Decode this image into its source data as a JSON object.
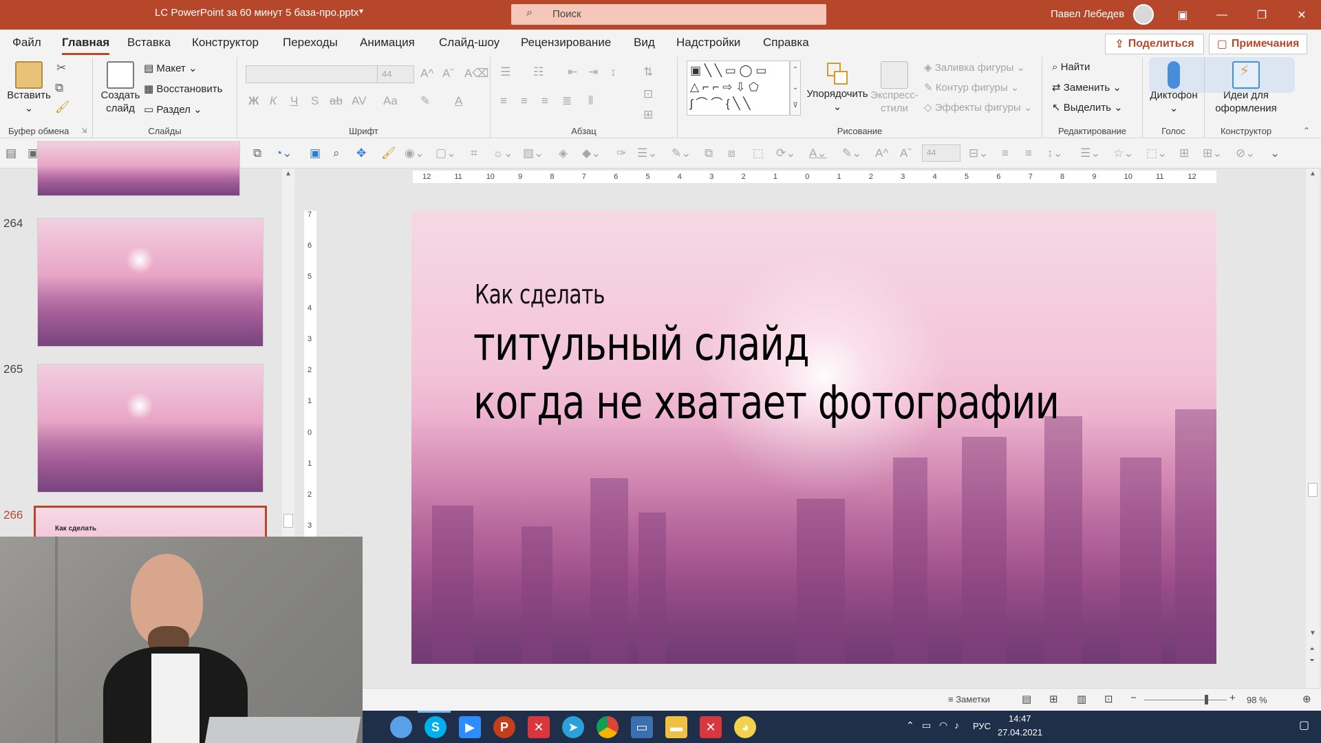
{
  "window": {
    "title": "LC PowerPoint за 60 минут 5 база-про.pptx",
    "search_placeholder": "Поиск",
    "user": "Павел Лебедев",
    "accent": "#b7472a"
  },
  "tabs": [
    "Файл",
    "Главная",
    "Вставка",
    "Конструктор",
    "Переходы",
    "Анимация",
    "Слайд-шоу",
    "Рецензирование",
    "Вид",
    "Надстройки",
    "Справка"
  ],
  "share_label": "Поделиться",
  "comments_label": "Примечания",
  "ribbon": {
    "clipboard": {
      "paste": "Вставить",
      "label": "Буфер обмена"
    },
    "slides": {
      "new_slide_line1": "Создать",
      "new_slide_line2": "слайд",
      "layout": "Макет",
      "reset": "Восстановить",
      "section": "Раздел",
      "label": "Слайды"
    },
    "font": {
      "size": "44",
      "label": "Шрифт",
      "bold": "Ж",
      "italic": "К",
      "underline": "Ч",
      "shadow": "S",
      "strike": "ab",
      "spacing": "AV",
      "case": "Aa"
    },
    "paragraph": {
      "label": "Абзац"
    },
    "drawing": {
      "arrange": "Упорядочить",
      "styles_line1": "Экспресс-",
      "styles_line2": "стили",
      "fill": "Заливка фигуры",
      "outline": "Контур фигуры",
      "effects": "Эффекты фигуры",
      "label": "Рисование"
    },
    "editing": {
      "find": "Найти",
      "replace": "Заменить",
      "select": "Выделить",
      "label": "Редактирование"
    },
    "voice": {
      "dictate": "Диктофон",
      "label": "Голос"
    },
    "designer": {
      "ideas_line1": "Идеи для",
      "ideas_line2": "оформления",
      "label": "Конструктор"
    }
  },
  "qat_font_size": "44",
  "thumbnails": [
    {
      "number": "264"
    },
    {
      "number": "265"
    },
    {
      "number": "266",
      "caption": "Как сделать"
    }
  ],
  "slide": {
    "subtitle": "Как сделать",
    "title_line1": "титульный слайд",
    "title_line2": "когда не хватает фотографии"
  },
  "ruler_ticks": [
    "12",
    "11",
    "10",
    "9",
    "8",
    "7",
    "6",
    "5",
    "4",
    "3",
    "2",
    "1",
    "0",
    "1",
    "2",
    "3",
    "4",
    "5",
    "6",
    "7",
    "8",
    "9",
    "10",
    "11",
    "12"
  ],
  "vruler_ticks": [
    "7",
    "6",
    "5",
    "4",
    "3",
    "2",
    "1",
    "0",
    "1",
    "2",
    "3"
  ],
  "status": {
    "notes": "Заметки",
    "zoom": "98 %"
  },
  "taskbar": {
    "lang": "РУС",
    "time": "14:47",
    "date": "27.04.2021"
  }
}
